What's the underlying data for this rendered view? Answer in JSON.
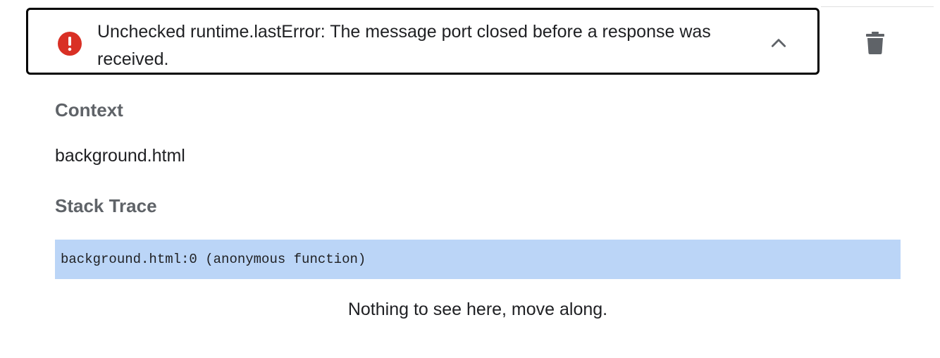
{
  "error": {
    "message": "Unchecked runtime.lastError: The message port closed before a response was received.",
    "icon": "error-icon",
    "icon_color": "#d93025",
    "expand_icon": "chevron-up-icon",
    "delete_icon": "trash-icon"
  },
  "context": {
    "heading": "Context",
    "value": "background.html"
  },
  "stack_trace": {
    "heading": "Stack Trace",
    "frames": [
      "background.html:0 (anonymous function)"
    ],
    "highlight_color": "#bbd5f7"
  },
  "footer": {
    "note": "Nothing to see here, move along."
  }
}
